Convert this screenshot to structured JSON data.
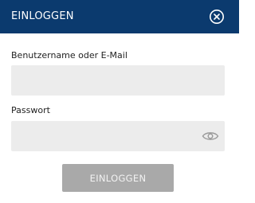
{
  "dialog": {
    "title": "EINLOGGEN",
    "close_icon": "close-circle-icon"
  },
  "form": {
    "username_label": "Benutzername oder E-Mail",
    "username_value": "",
    "username_placeholder": "",
    "password_label": "Passwort",
    "password_value": "",
    "password_placeholder": "",
    "password_toggle_icon": "eye-icon",
    "submit_label": "EINLOGGEN"
  },
  "colors": {
    "header_bg": "#0b3a6e",
    "input_bg": "#ececec",
    "button_bg": "#a9a9a9"
  }
}
